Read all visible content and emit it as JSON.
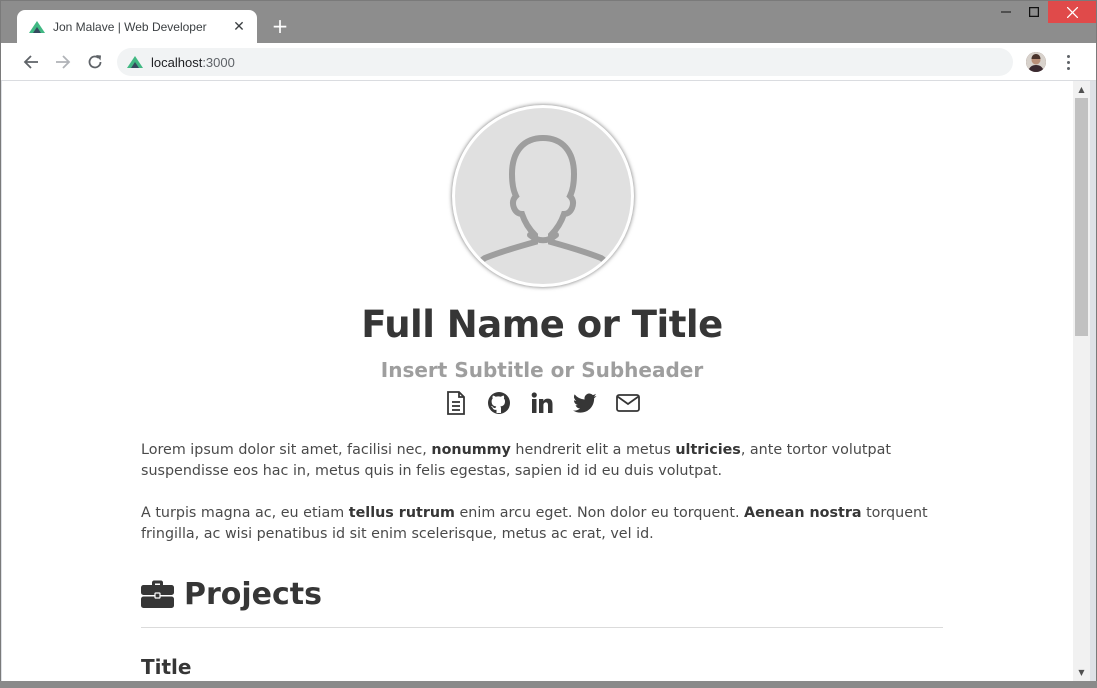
{
  "browser": {
    "tab_title": "Jon Malave | Web Developer",
    "tab_close": "✕",
    "new_tab": "+",
    "url_host": "localhost",
    "url_port": ":3000",
    "window_controls": {
      "minimize": "—",
      "maximize": "☐",
      "close": "✕"
    },
    "icons": [
      "back-icon",
      "forward-icon",
      "reload-icon",
      "vue-logo-icon",
      "profile-avatar",
      "menu-dots-icon"
    ]
  },
  "profile": {
    "name": "Full Name or Title",
    "subtitle": "Insert Subtitle or Subheader",
    "socials": [
      "resume-icon",
      "github-icon",
      "linkedin-icon",
      "twitter-icon",
      "email-icon"
    ]
  },
  "bio": {
    "p1": [
      {
        "text": "Lorem ipsum dolor sit amet, facilisi nec, ",
        "bold": false
      },
      {
        "text": "nonummy",
        "bold": true
      },
      {
        "text": " hendrerit elit a metus ",
        "bold": false
      },
      {
        "text": "ultricies",
        "bold": true
      },
      {
        "text": ", ante tortor volutpat suspendisse eos hac in, metus quis in felis egestas, sapien id id eu duis volutpat.",
        "bold": false
      }
    ],
    "p2": [
      {
        "text": "A turpis magna ac, eu etiam ",
        "bold": false
      },
      {
        "text": "tellus rutrum",
        "bold": true
      },
      {
        "text": " enim arcu eget. Non dolor eu torquent. ",
        "bold": false
      },
      {
        "text": "Aenean nostra",
        "bold": true
      },
      {
        "text": " torquent fringilla, ac wisi penatibus id sit enim scelerisque, metus ac erat, vel id.",
        "bold": false
      }
    ]
  },
  "projects": {
    "heading": "Projects",
    "icon": "briefcase-icon",
    "first_title": "Title"
  },
  "colors": {
    "heading": "#363636",
    "subtitle": "#9e9e9e",
    "body_text": "#4a4a4a",
    "vue_green": "#41b883",
    "vue_dark": "#35495e",
    "close_red": "#e04a4a"
  }
}
